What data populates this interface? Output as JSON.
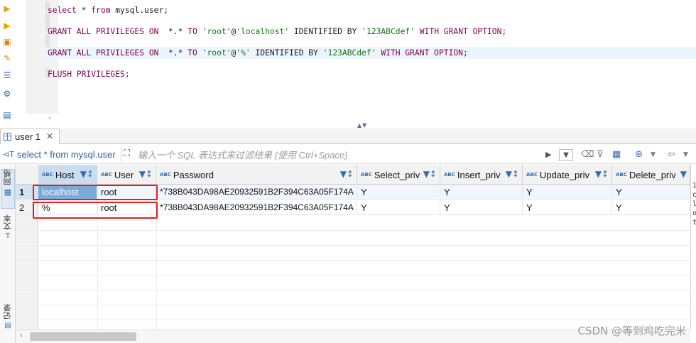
{
  "toolbar_icons": [
    "run-icon",
    "run-selected-icon",
    "explain-icon",
    "format-icon",
    "history-icon",
    "settings-icon",
    "export-icon"
  ],
  "editor": {
    "lines": [
      [
        {
          "t": "select",
          "c": "kw"
        },
        {
          "t": " * ",
          "c": "plain"
        },
        {
          "t": "from",
          "c": "kw"
        },
        {
          "t": " mysql.user;",
          "c": "plain"
        }
      ],
      [
        {
          "t": "GRANT ALL PRIVILEGES ON",
          "c": "kw"
        },
        {
          "t": "  *.* ",
          "c": "plain"
        },
        {
          "t": "TO",
          "c": "kw"
        },
        {
          "t": " ",
          "c": "plain"
        },
        {
          "t": "'root'",
          "c": "str"
        },
        {
          "t": "@",
          "c": "plain"
        },
        {
          "t": "'localhost'",
          "c": "str"
        },
        {
          "t": " IDENTIFIED BY ",
          "c": "plain-kw"
        },
        {
          "t": "'123ABCdef'",
          "c": "str"
        },
        {
          "t": " WITH GRANT OPTION;",
          "c": "kw"
        }
      ],
      [
        {
          "t": "GRANT ALL PRIVILEGES ON",
          "c": "kw"
        },
        {
          "t": "  *.* ",
          "c": "plain"
        },
        {
          "t": "TO",
          "c": "kw"
        },
        {
          "t": " ",
          "c": "plain"
        },
        {
          "t": "'root'",
          "c": "str"
        },
        {
          "t": "@",
          "c": "plain"
        },
        {
          "t": "'%'",
          "c": "str"
        },
        {
          "t": " IDENTIFIED BY ",
          "c": "plain-kw"
        },
        {
          "t": "'123ABCdef'",
          "c": "str"
        },
        {
          "t": " WITH GRANT OPTION;",
          "c": "kw"
        }
      ],
      [
        {
          "t": "FLUSH PRIVILEGES;",
          "c": "kw"
        }
      ]
    ]
  },
  "result_tab": {
    "label": "user 1",
    "close": "✕"
  },
  "filter": {
    "query": "select * from mysql.user",
    "placeholder": "输入一个 SQL 表达式来过滤结果 (使用 Ctrl+Space)"
  },
  "side_tabs": [
    "网格",
    "文本",
    "记录"
  ],
  "columns": [
    "Host",
    "User",
    "Password",
    "Select_priv",
    "Insert_priv",
    "Update_priv",
    "Delete_priv"
  ],
  "rows": [
    {
      "num": "1",
      "cells": [
        "localhost",
        "root",
        "*738B043DA98AE20932591B2F394C63A05F174A",
        "Y",
        "Y",
        "Y",
        "Y"
      ]
    },
    {
      "num": "2",
      "cells": [
        "%",
        "root",
        "*738B043DA98AE20932591B2F394C63A05F174A",
        "Y",
        "Y",
        "Y",
        "Y"
      ]
    }
  ],
  "right_strip_text": "1 c l o t",
  "watermark": "CSDN @等到鸡吃完米",
  "colors": {
    "keyword": "#7f0055",
    "string": "#117711",
    "selected_cell": "#7caad8",
    "annotation": "#e02020"
  }
}
